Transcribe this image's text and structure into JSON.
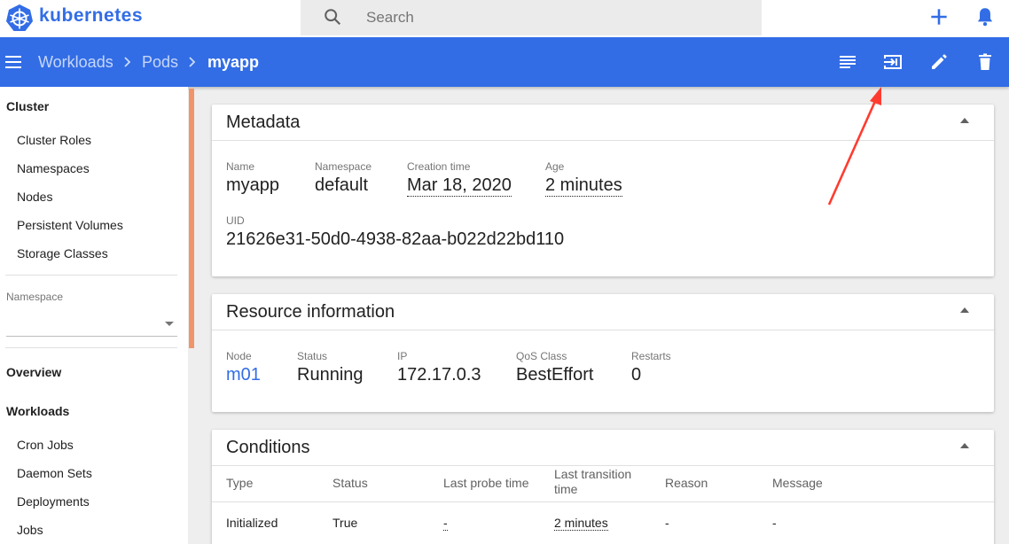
{
  "header": {
    "brand": "kubernetes",
    "search_placeholder": "Search"
  },
  "toolbar": {
    "breadcrumbs": [
      "Workloads",
      "Pods",
      "myapp"
    ],
    "actions": [
      "logs-icon",
      "exec-icon",
      "edit-icon",
      "delete-icon"
    ]
  },
  "sidebar": {
    "cluster_heading": "Cluster",
    "cluster_items": [
      "Cluster Roles",
      "Namespaces",
      "Nodes",
      "Persistent Volumes",
      "Storage Classes"
    ],
    "namespace_label": "Namespace",
    "namespace_value": "",
    "overview": "Overview",
    "workloads_heading": "Workloads",
    "workloads_items": [
      "Cron Jobs",
      "Daemon Sets",
      "Deployments",
      "Jobs"
    ]
  },
  "metadata": {
    "title": "Metadata",
    "name_label": "Name",
    "name": "myapp",
    "namespace_label": "Namespace",
    "namespace": "default",
    "creation_label": "Creation time",
    "creation": "Mar 18, 2020",
    "age_label": "Age",
    "age": "2 minutes",
    "uid_label": "UID",
    "uid": "21626e31-50d0-4938-82aa-b022d22bd110"
  },
  "resource": {
    "title": "Resource information",
    "node_label": "Node",
    "node": "m01",
    "status_label": "Status",
    "status": "Running",
    "ip_label": "IP",
    "ip": "172.17.0.3",
    "qos_label": "QoS Class",
    "qos": "BestEffort",
    "restarts_label": "Restarts",
    "restarts": "0"
  },
  "conditions": {
    "title": "Conditions",
    "columns": [
      "Type",
      "Status",
      "Last probe time",
      "Last transition time",
      "Reason",
      "Message"
    ],
    "rows": [
      {
        "type": "Initialized",
        "status": "True",
        "probe": "-",
        "transition": "2 minutes",
        "reason": "-",
        "message": "-"
      }
    ]
  },
  "colors": {
    "brand": "#326de6",
    "accent": "#f0956a",
    "annotation": "#ff3b30"
  }
}
